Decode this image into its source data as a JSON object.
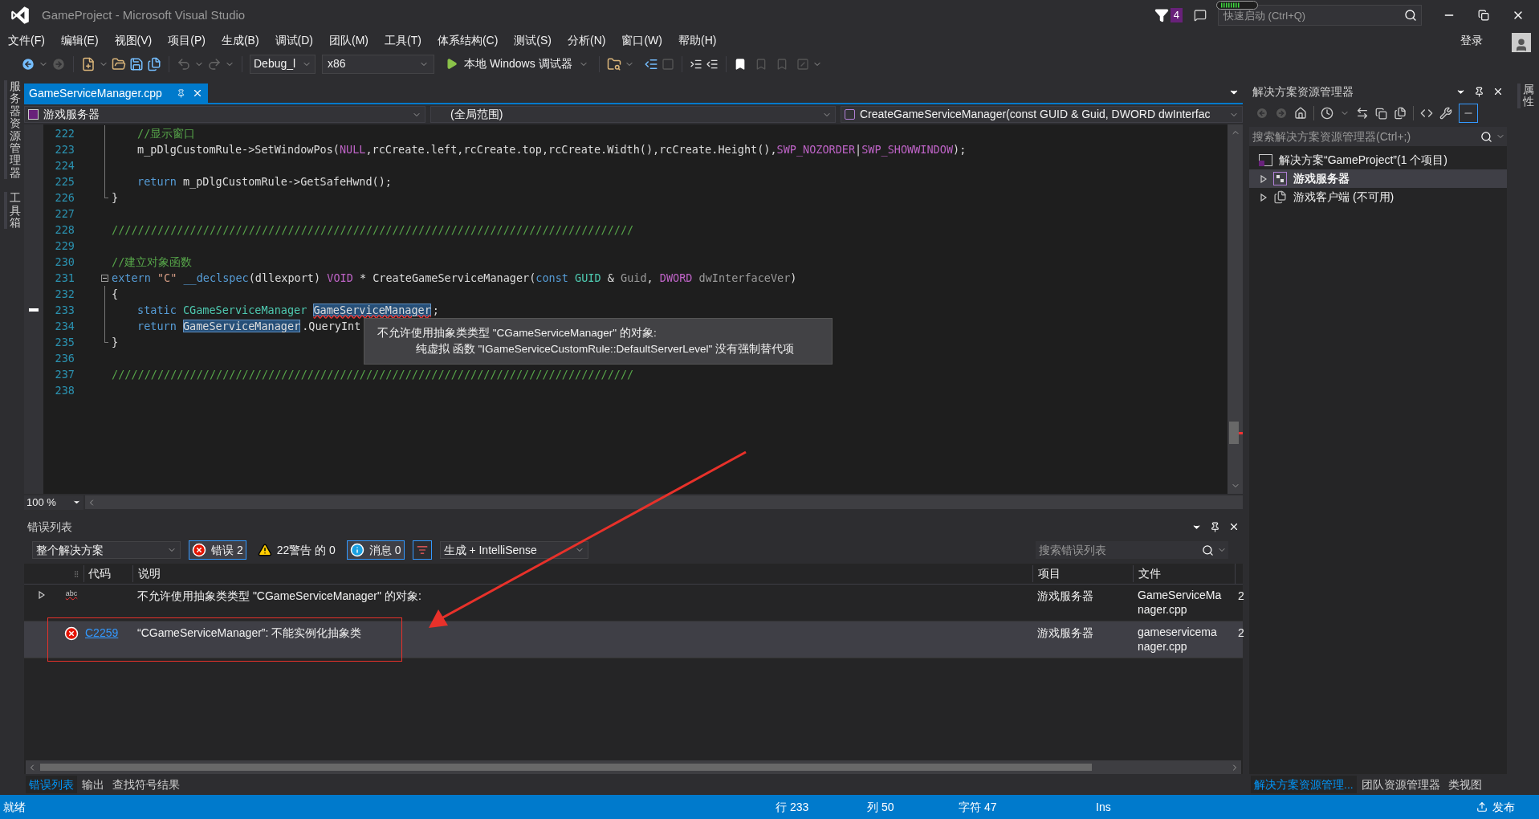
{
  "window": {
    "title": "GameProject - Microsoft Visual Studio",
    "notification_count": "4",
    "quick_launch": {
      "placeholder": "快速启动 (Ctrl+Q)"
    },
    "sign_in": "登录"
  },
  "menu": [
    "文件(F)",
    "编辑(E)",
    "视图(V)",
    "项目(P)",
    "生成(B)",
    "调试(D)",
    "团队(M)",
    "工具(T)",
    "体系结构(C)",
    "测试(S)",
    "分析(N)",
    "窗口(W)",
    "帮助(H)"
  ],
  "toolbar": {
    "configuration": "Debug_l",
    "platform": "x86",
    "run": "本地 Windows 调试器"
  },
  "left_strip": [
    "服务器资源管理器",
    "工具箱"
  ],
  "right_strip": [
    "属性"
  ],
  "editor": {
    "tabs": [
      {
        "label": "GameServiceManager.cpp",
        "selected": true
      }
    ],
    "nav": [
      "游戏服务器",
      "(全局范围)",
      "CreateGameServiceManager(const GUID & Guid, DWORD dwInterfac"
    ],
    "lines": [
      {
        "number": "222",
        "kind": "fold_body",
        "indented": true,
        "tokens": [
          {
            "kind": "comment",
            "text": "//显示窗口"
          }
        ]
      },
      {
        "number": "223",
        "kind": "fold_body",
        "indented": true,
        "tokens": [
          {
            "kind": "plain",
            "text": "m_pDlgCustomRule->SetWindowPos("
          },
          {
            "kind": "macro",
            "text": "NULL"
          },
          {
            "kind": "plain",
            "text": ",rcCreate.left,rcCreate.top,rcCreate.Width(),rcCreate.Height(),"
          },
          {
            "kind": "macro",
            "text": "SWP_NOZORDER"
          },
          {
            "kind": "plain",
            "text": "|"
          },
          {
            "kind": "macro",
            "text": "SWP_SHOWWINDOW"
          },
          {
            "kind": "plain",
            "text": ");"
          }
        ]
      },
      {
        "number": "224",
        "kind": "fold_body"
      },
      {
        "number": "225",
        "kind": "fold_body",
        "indented": true,
        "tokens": [
          {
            "kind": "keyword",
            "text": "return"
          },
          {
            "kind": "plain",
            "text": " m_pDlgCustomRule->GetSafeHwnd();"
          }
        ]
      },
      {
        "number": "226",
        "kind": "fold_end",
        "indented": false,
        "tokens": [
          {
            "kind": "plain",
            "text": "}"
          }
        ]
      },
      {
        "number": "227",
        "kind": "plain"
      },
      {
        "number": "228",
        "kind": "plain",
        "indented": false,
        "tokens": [
          {
            "kind": "comment",
            "text": "////////////////////////////////////////////////////////////////////////////////"
          }
        ]
      },
      {
        "number": "229",
        "kind": "plain"
      },
      {
        "number": "230",
        "kind": "plain",
        "indented": false,
        "tokens": [
          {
            "kind": "comment",
            "text": "//建立对象函数"
          }
        ]
      },
      {
        "number": "231",
        "kind": "fold_start",
        "indented": false,
        "tokens": [
          {
            "kind": "keyword",
            "text": "extern"
          },
          {
            "kind": "string",
            "text": " \"C\""
          },
          {
            "kind": "keyword",
            "text": " __declspec"
          },
          {
            "kind": "plain",
            "text": "(dllexport) "
          },
          {
            "kind": "macro",
            "text": "VOID"
          },
          {
            "kind": "plain",
            "text": " * CreateGameServiceManager("
          },
          {
            "kind": "keyword",
            "text": "const"
          },
          {
            "kind": "type",
            "text": " GUID"
          },
          {
            "kind": "plain",
            "text": " & "
          },
          {
            "kind": "param",
            "text": "Guid"
          },
          {
            "kind": "plain",
            "text": ", "
          },
          {
            "kind": "macro",
            "text": "DWORD"
          },
          {
            "kind": "param",
            "text": " dwInterfaceVer"
          },
          {
            "kind": "plain",
            "text": ")"
          }
        ]
      },
      {
        "number": "232",
        "kind": "fold_body",
        "indented": false,
        "tokens": [
          {
            "kind": "plain",
            "text": "{"
          }
        ]
      },
      {
        "number": "233",
        "kind": "fold_body",
        "indented": true,
        "marker": true,
        "tokens": [
          {
            "kind": "keyword",
            "text": "static"
          },
          {
            "kind": "type",
            "text": " CGameServiceManager "
          },
          {
            "kind": "highlight",
            "text": "GameServiceManager",
            "squiggle": true
          },
          {
            "kind": "plain",
            "text": ";"
          }
        ]
      },
      {
        "number": "234",
        "kind": "fold_body",
        "indented": true,
        "marker": false,
        "tokens": [
          {
            "kind": "keyword",
            "text": "return "
          },
          {
            "kind": "highlight",
            "text": "GameServiceManager",
            "squiggle": false
          },
          {
            "kind": "plain",
            "text": ".QueryInt"
          }
        ]
      },
      {
        "number": "235",
        "kind": "fold_end",
        "indented": false,
        "tokens": [
          {
            "kind": "plain",
            "text": "}"
          }
        ]
      },
      {
        "number": "236",
        "kind": "plain"
      },
      {
        "number": "237",
        "kind": "plain",
        "indented": false,
        "tokens": [
          {
            "kind": "comment",
            "text": "////////////////////////////////////////////////////////////////////////////////"
          }
        ]
      },
      {
        "number": "238",
        "kind": "plain"
      }
    ],
    "tooltip": [
      "不允许使用抽象类类型 \"CGameServiceManager\" 的对象:",
      "纯虚拟 函数 \"IGameServiceCustomRule::DefaultServerLevel\" 没有强制替代项"
    ],
    "zoom": "100 %"
  },
  "error_list": {
    "title": "错误列表",
    "scope": "整个解决方案",
    "filters": [
      {
        "kind": "error",
        "label": "错误 2",
        "selected": true
      },
      {
        "kind": "warning",
        "label": "22警告 的 0",
        "selected": false
      },
      {
        "kind": "info",
        "label": "消息 0",
        "selected": true
      }
    ],
    "source": "生成 + IntelliSense",
    "search": {
      "placeholder": "搜索错误列表"
    },
    "columns": [
      "代码",
      "说明",
      "项目",
      "文件"
    ],
    "rows": [
      {
        "kind": "intellisense",
        "icon_text": "abc",
        "expandable": true,
        "selected": false,
        "description": "不允许使用抽象类类型 \"CGameServiceManager\" 的对象:",
        "project": "游戏服务器",
        "file": "GameServiceManager.cpp",
        "column_5": "2"
      },
      {
        "kind": "error",
        "code": "C2259",
        "expandable": false,
        "selected": true,
        "description": "“CGameServiceManager”: 不能实例化抽象类",
        "project": "游戏服务器",
        "file": "gameservicemanager.cpp",
        "column_5": "2"
      }
    ],
    "tabs": [
      {
        "label": "错误列表",
        "selected": true
      },
      {
        "label": "输出",
        "selected": false
      },
      {
        "label": "查找符号结果",
        "selected": false
      }
    ]
  },
  "solution_explorer": {
    "title": "解决方案资源管理器",
    "search": {
      "placeholder": "搜索解决方案资源管理器(Ctrl+;)"
    },
    "tree": [
      {
        "label": "解决方案“GameProject”(1 个项目)",
        "kind": "solution",
        "selected": false,
        "children": [
          {
            "label": "游戏服务器",
            "kind": "project",
            "selected": true,
            "expanded": false
          },
          {
            "label": "游戏客户端 (不可用)",
            "kind": "unloaded",
            "selected": false,
            "expanded": false
          }
        ]
      }
    ],
    "tabs": [
      {
        "label": "解决方案资源管理...",
        "selected": true
      },
      {
        "label": "团队资源管理器",
        "selected": false
      },
      {
        "label": "类视图",
        "selected": false
      }
    ]
  },
  "status_bar": {
    "ready": "就绪",
    "line": "行 233",
    "column": "列 50",
    "char": "字符 47",
    "mode": "Ins",
    "publish": "发布"
  }
}
